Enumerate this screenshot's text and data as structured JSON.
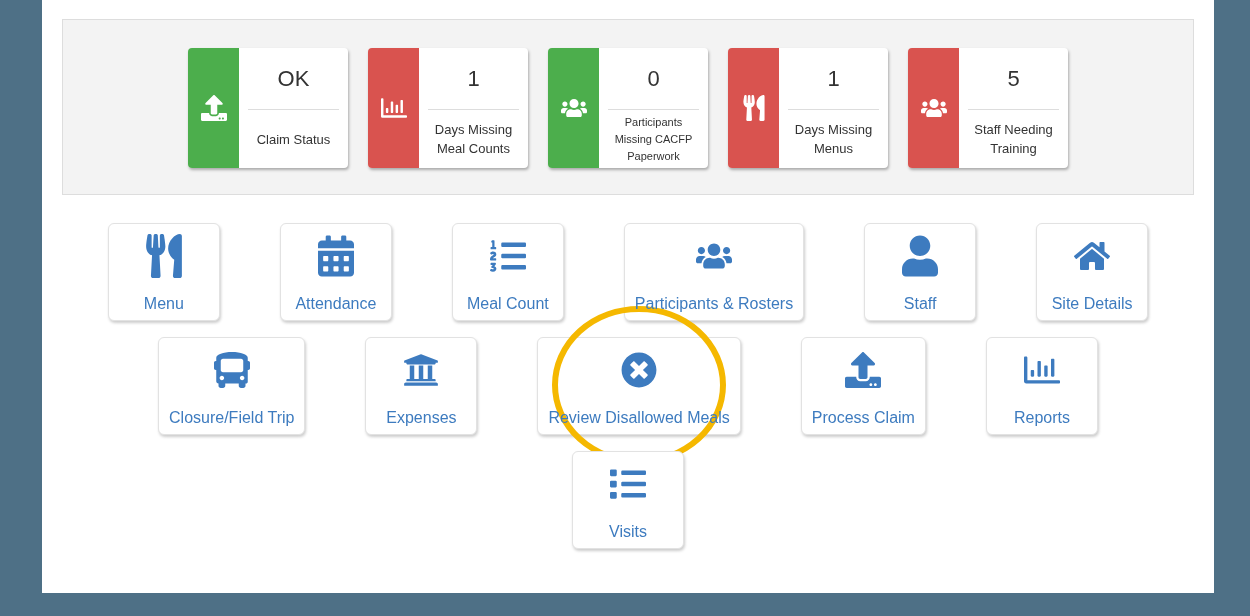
{
  "status_cards": [
    {
      "value": "OK",
      "label": "Claim Status",
      "color": "#4cae4c"
    },
    {
      "value": "1",
      "label": "Days Missing Meal Counts",
      "color": "#d9534f"
    },
    {
      "value": "0",
      "label": "Participants Missing CACFP Paperwork",
      "color": "#4cae4c"
    },
    {
      "value": "1",
      "label": "Days Missing Menus",
      "color": "#d9534f"
    },
    {
      "value": "5",
      "label": "Staff Needing Training",
      "color": "#d9534f"
    }
  ],
  "tile_rows": [
    [
      {
        "label": "Menu",
        "circled": false
      },
      {
        "label": "Attendance",
        "circled": false
      },
      {
        "label": "Meal Count",
        "circled": false
      },
      {
        "label": "Participants & Rosters",
        "circled": false
      },
      {
        "label": "Staff",
        "circled": false
      },
      {
        "label": "Site Details",
        "circled": false
      }
    ],
    [
      {
        "label": "Closure/Field Trip",
        "circled": false
      },
      {
        "label": "Expenses",
        "circled": false
      },
      {
        "label": "Review Disallowed Meals",
        "circled": true
      },
      {
        "label": "Process Claim",
        "circled": false
      },
      {
        "label": "Reports",
        "circled": false
      }
    ],
    [
      {
        "label": "Visits",
        "circled": false
      }
    ]
  ]
}
